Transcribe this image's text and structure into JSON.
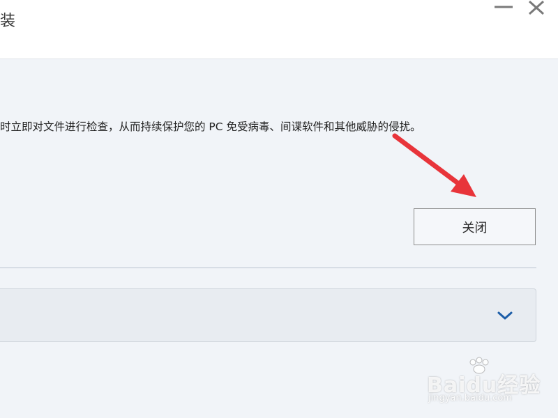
{
  "window": {
    "title": "合装",
    "minimize_icon": "minimize-icon",
    "close_icon": "close-icon"
  },
  "main": {
    "description": "时立即对文件进行检查，从而持续保护您的 PC 免受病毒、间谍软件和其他威胁的侵扰。",
    "close_button_label": "关闭",
    "expander_icon": "chevron-down-icon"
  },
  "annotation": {
    "arrow_color": "#e8343a"
  },
  "watermark": {
    "brand": "Baidu经验",
    "url": "jingyan.baidu.com"
  },
  "colors": {
    "accent": "#1d5ea8",
    "background": "#f1f4f8"
  }
}
